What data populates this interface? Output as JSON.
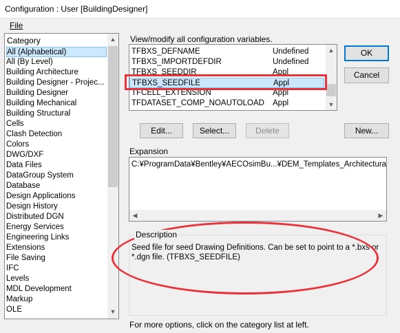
{
  "window": {
    "title": "Configuration : User [BuildingDesigner]"
  },
  "menu": {
    "file": "File"
  },
  "category": {
    "header": "Category",
    "items": [
      "All (Alphabetical)",
      "All (By Level)",
      "Building Architecture",
      "Building Designer - Projec...",
      "Building Designer",
      "Building Mechanical",
      "Building Structural",
      "Cells",
      "Clash Detection",
      "Colors",
      "DWG/DXF",
      "Data Files",
      "DataGroup System",
      "Database",
      "Design Applications",
      "Design History",
      "Distributed DGN",
      "Energy Services",
      "Engineering Links",
      "Extensions",
      "File Saving",
      "IFC",
      "Levels",
      "MDL Development",
      "Markup",
      "OLE"
    ]
  },
  "variables": {
    "header": "View/modify all configuration variables.",
    "rows": [
      {
        "name": "TFBXS_DEFNAME",
        "level": "Undefined"
      },
      {
        "name": "TFBXS_IMPORTDEFDIR",
        "level": "Undefined"
      },
      {
        "name": "TFBXS_SEEDDIR",
        "level": "Appl"
      },
      {
        "name": "TFBXS_SEEDFILE",
        "level": "Appl"
      },
      {
        "name": "TFCELL_EXTENSION",
        "level": "Appl"
      },
      {
        "name": "TFDATASET_COMP_NOAUTOLOAD",
        "level": "Appl"
      }
    ]
  },
  "buttons": {
    "ok": "OK",
    "cancel": "Cancel",
    "edit": "Edit...",
    "select": "Select...",
    "delete": "Delete",
    "new": "New..."
  },
  "expansion": {
    "label": "Expansion",
    "value": "C:¥ProgramData¥Bentley¥AECOsimBu...¥DEM_Templates_Architectural.dgn"
  },
  "description": {
    "label": "Description",
    "text": "Seed file for seed Drawing Definitions. Can be set to point to a *.bxs or *.dgn file. (TFBXS_SEEDFILE)"
  },
  "footer": {
    "text": "For more options, click on the category list at left."
  },
  "colors": {
    "highlight": "#e8333a",
    "selection": "#cce8ff",
    "default_border": "#0078d7"
  }
}
